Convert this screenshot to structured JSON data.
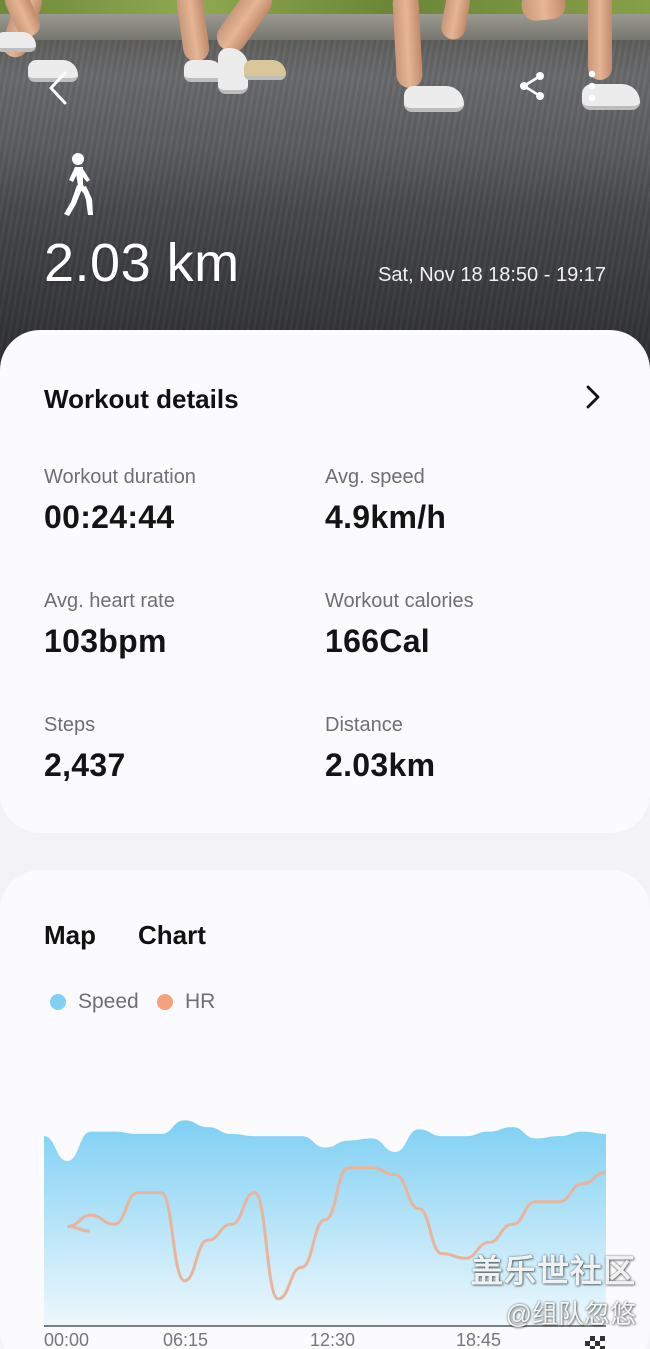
{
  "hero": {
    "distance": "2.03 km",
    "date_range": "Sat, Nov 18 18:50 - 19:17",
    "activity_icon": "walking-person-icon",
    "back_icon": "back-arrow-icon",
    "share_icon": "share-icon",
    "more_icon": "more-vertical-icon"
  },
  "details": {
    "title": "Workout details",
    "stats": [
      {
        "label": "Workout duration",
        "value": "00:24:44",
        "unit": ""
      },
      {
        "label": "Avg. speed",
        "value": "4.9",
        "unit": "km/h"
      },
      {
        "label": "Avg. heart rate",
        "value": "103",
        "unit": "bpm"
      },
      {
        "label": "Workout calories",
        "value": "166",
        "unit": "Cal"
      },
      {
        "label": "Steps",
        "value": "2,437",
        "unit": ""
      },
      {
        "label": "Distance",
        "value": "2.03",
        "unit": "km"
      }
    ]
  },
  "chart_section": {
    "tabs": [
      "Map",
      "Chart"
    ],
    "legend": [
      {
        "name": "Speed",
        "color": "#7fd0f3"
      },
      {
        "name": "HR",
        "color": "#f4a27e"
      }
    ]
  },
  "chart_data": {
    "type": "area",
    "x_ticks": [
      "00:00",
      "06:15",
      "12:30",
      "18:45"
    ],
    "series": [
      {
        "name": "Speed",
        "color": "#7fd0f3",
        "x": [
          0,
          1,
          2,
          3,
          4,
          5,
          6,
          7,
          8,
          9,
          10,
          11,
          12,
          13,
          14,
          15,
          16,
          17,
          18,
          19,
          20,
          21,
          22,
          23,
          24
        ],
        "values": [
          0.84,
          0.73,
          0.86,
          0.86,
          0.85,
          0.85,
          0.91,
          0.88,
          0.85,
          0.84,
          0.84,
          0.84,
          0.79,
          0.82,
          0.83,
          0.77,
          0.87,
          0.84,
          0.84,
          0.86,
          0.88,
          0.83,
          0.84,
          0.86,
          0.85
        ]
      },
      {
        "name": "HR",
        "color": "#f4a27e",
        "x": [
          0,
          1,
          2,
          3,
          4,
          5,
          6,
          7,
          8,
          9,
          10,
          11,
          12,
          13,
          14,
          15,
          16,
          17,
          18,
          19,
          20,
          21,
          22,
          23,
          24
        ],
        "values": [
          0.42,
          0.44,
          0.49,
          0.45,
          0.59,
          0.59,
          0.2,
          0.38,
          0.45,
          0.59,
          0.12,
          0.26,
          0.47,
          0.7,
          0.7,
          0.67,
          0.52,
          0.32,
          0.3,
          0.37,
          0.45,
          0.55,
          0.55,
          0.63,
          0.68
        ]
      }
    ]
  },
  "watermark": {
    "line1": "盖乐世社区",
    "line2": "@组队忽悠"
  }
}
